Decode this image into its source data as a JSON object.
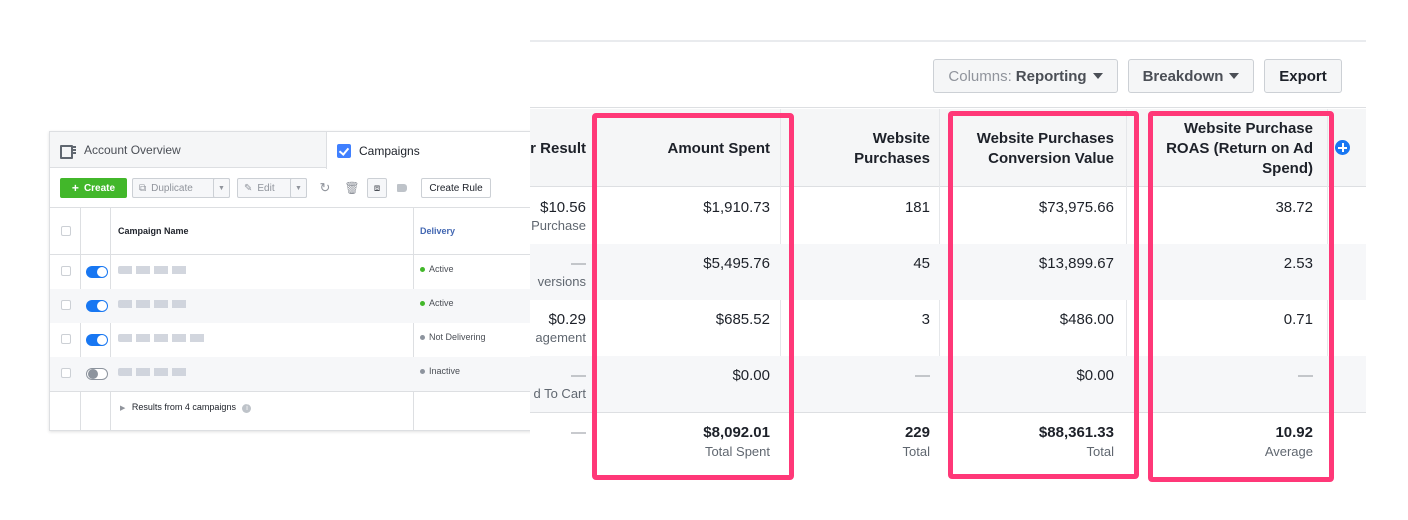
{
  "left_panel": {
    "tabs": {
      "overview": "Account Overview",
      "campaigns": "Campaigns"
    },
    "toolbar": {
      "create": "Create",
      "duplicate": "Duplicate",
      "edit": "Edit",
      "create_rule": "Create Rule"
    },
    "headers": {
      "name": "Campaign Name",
      "delivery": "Delivery"
    },
    "rows": [
      {
        "status": "Active",
        "status_color": "#42b72a",
        "toggle": "on"
      },
      {
        "status": "Active",
        "status_color": "#42b72a",
        "toggle": "on"
      },
      {
        "status": "Not Delivering",
        "status_color": "#8d949e",
        "toggle": "on"
      },
      {
        "status": "Inactive",
        "status_color": "#8d949e",
        "toggle": "off"
      }
    ],
    "results_text": "Results from 4 campaigns"
  },
  "right_panel": {
    "columns_btn": {
      "label": "Columns:",
      "value": "Reporting"
    },
    "breakdown_btn": "Breakdown",
    "export_btn": "Export",
    "headers": {
      "cost_per_result": "r Result",
      "amount_spent": "Amount Spent",
      "purchases_1": "Website",
      "purchases_2": "Purchases",
      "conv_1": "Website Purchases",
      "conv_2": "Conversion Value",
      "roas_1": "Website Purchase",
      "roas_2": "ROAS (Return on Ad",
      "roas_3": "Spend)"
    },
    "rows": [
      {
        "cpr": "$10.56",
        "cpr_sub": "Purchase",
        "spent": "$1,910.73",
        "purchases": "181",
        "conv": "$73,975.66",
        "roas": "38.72"
      },
      {
        "cpr": "—",
        "cpr_sub": "versions",
        "spent": "$5,495.76",
        "purchases": "45",
        "conv": "$13,899.67",
        "roas": "2.53"
      },
      {
        "cpr": "$0.29",
        "cpr_sub": "agement",
        "spent": "$685.52",
        "purchases": "3",
        "conv": "$486.00",
        "roas": "0.71"
      },
      {
        "cpr": "—",
        "cpr_sub": "d To Cart",
        "spent": "$0.00",
        "purchases": "—",
        "conv": "$0.00",
        "roas": "—"
      }
    ],
    "totals": {
      "cpr": "—",
      "spent": "$8,092.01",
      "spent_sub": "Total Spent",
      "purchases": "229",
      "purchases_sub": "Total",
      "conv": "$88,361.33",
      "conv_sub": "Total",
      "roas": "10.92",
      "roas_sub": "Average"
    }
  },
  "colors": {
    "highlight": "#ff3878",
    "create_green": "#42b72a",
    "link_blue": "#4267b2"
  }
}
